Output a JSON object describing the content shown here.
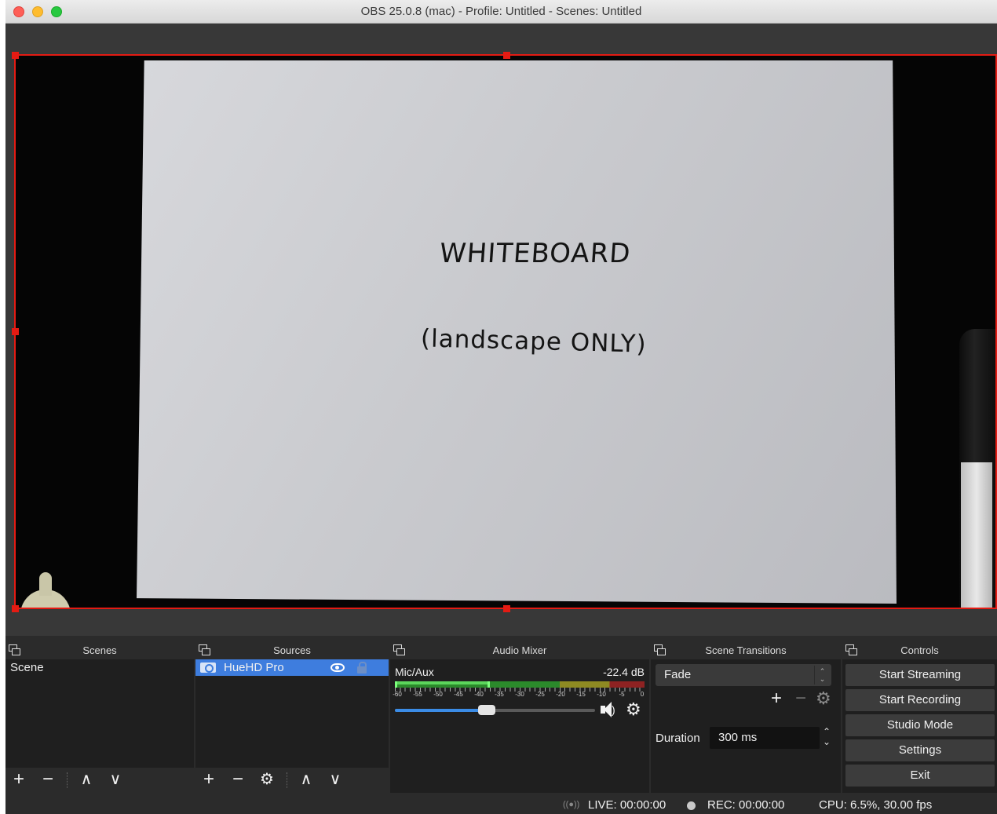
{
  "window": {
    "title": "OBS 25.0.8 (mac) - Profile: Untitled - Scenes: Untitled"
  },
  "preview": {
    "whiteboard_line1": "WHITEBOARD",
    "whiteboard_line2": "(landscape ONLY)"
  },
  "docks": {
    "scenes": {
      "title": "Scenes",
      "items": [
        "Scene"
      ],
      "toolbar": {
        "add": "+",
        "remove": "−",
        "up": "∧",
        "down": "∨"
      }
    },
    "sources": {
      "title": "Sources",
      "items": [
        {
          "label": "HueHD Pro",
          "icon": "camera-icon",
          "visible": true,
          "locked": false
        }
      ],
      "toolbar": {
        "add": "+",
        "remove": "−",
        "settings": "⚙",
        "up": "∧",
        "down": "∨"
      }
    },
    "audio_mixer": {
      "title": "Audio Mixer",
      "channel": {
        "name": "Mic/Aux",
        "level": "-22.4 dB",
        "volume_fraction": 0.46
      },
      "scale": [
        "-60",
        "-55",
        "-50",
        "-45",
        "-40",
        "-35",
        "-30",
        "-25",
        "-20",
        "-15",
        "-10",
        "-5",
        "0"
      ]
    },
    "scene_transitions": {
      "title": "Scene Transitions",
      "transition": "Fade",
      "add": "+",
      "remove": "−",
      "duration_label": "Duration",
      "duration_value": "300 ms"
    },
    "controls": {
      "title": "Controls",
      "buttons": [
        "Start Streaming",
        "Start Recording",
        "Studio Mode",
        "Settings",
        "Exit"
      ]
    }
  },
  "status": {
    "live": "LIVE: 00:00:00",
    "rec": "REC: 00:00:00",
    "cpu": "CPU: 6.5%, 30.00 fps"
  },
  "colors": {
    "accent": "#3e7dde",
    "selection_border": "#e41b13",
    "dock_bg": "#1f1f1f",
    "panel_bg": "#2b2b2b"
  }
}
